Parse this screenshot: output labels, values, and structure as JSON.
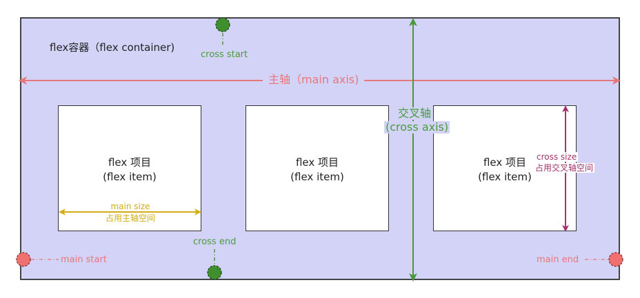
{
  "container": {
    "label": "flex容器（flex container)"
  },
  "axes": {
    "main_axis_label": "主轴（main axis)",
    "cross_axis_label_line1": "交叉轴",
    "cross_axis_label_line2": "(cross axis)"
  },
  "markers": {
    "cross_start": "cross start",
    "cross_end": "cross end",
    "main_start": "main start",
    "main_end": "main end"
  },
  "items": [
    {
      "line1": "flex 项目",
      "line2": "(flex item)"
    },
    {
      "line1": "flex 项目",
      "line2": "(flex item)"
    },
    {
      "line1": "flex 项目",
      "line2": "(flex item)"
    }
  ],
  "sizes": {
    "main_size_line1": "main size",
    "main_size_line2": "占用主轴空间",
    "cross_size_line1": "cross size",
    "cross_size_line2": "占用交叉轴空间"
  },
  "colors": {
    "container_fill": "#d3d3f8",
    "main_axis": "#e8767a",
    "cross_axis": "#4a9a3c",
    "main_size": "#d1ae17",
    "cross_size": "#a3336d",
    "main_dot": "#f07070",
    "cross_dot": "#3f8f2f"
  }
}
